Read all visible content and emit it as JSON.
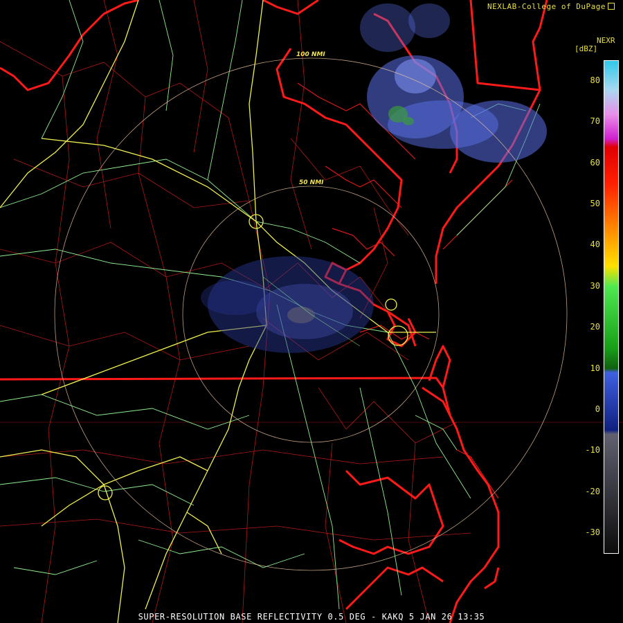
{
  "header": {
    "credit": "NEXLAB-College of DuPage",
    "credit_icon": "external-link-icon"
  },
  "legend": {
    "title": "NEXR",
    "unit": "[dBZ]",
    "ticks": [
      "80",
      "70",
      "60",
      "50",
      "40",
      "30",
      "20",
      "10",
      "0",
      "-10",
      "-20",
      "-30"
    ],
    "tick_values": [
      80,
      70,
      60,
      50,
      40,
      30,
      20,
      10,
      0,
      -10,
      -20,
      -30
    ],
    "range": [
      -35,
      85
    ],
    "color_stops": [
      {
        "value": 85,
        "color": "#30c8e8"
      },
      {
        "value": 78,
        "color": "#a8d8f0"
      },
      {
        "value": 72,
        "color": "#e890e8"
      },
      {
        "value": 66,
        "color": "#d020d0"
      },
      {
        "value": 64,
        "color": "#e00000"
      },
      {
        "value": 55,
        "color": "#ff2000"
      },
      {
        "value": 45,
        "color": "#ff8000"
      },
      {
        "value": 35,
        "color": "#ffe000"
      },
      {
        "value": 30,
        "color": "#50e850"
      },
      {
        "value": 15,
        "color": "#18a018"
      },
      {
        "value": 10,
        "color": "#106010"
      },
      {
        "value": 9,
        "color": "#4060e0"
      },
      {
        "value": -5,
        "color": "#102080"
      },
      {
        "value": -6,
        "color": "#606070"
      },
      {
        "value": -35,
        "color": "#0c0c0c"
      }
    ]
  },
  "rings": {
    "inner_label": "50 NMI",
    "outer_label": "100 NMI"
  },
  "colors": {
    "border": "#ff1a1a",
    "county": "#c01818",
    "roads": "#8ef08e",
    "interstate": "#f0f050",
    "echo": "#5a70e8",
    "ring": "#f0c8a0"
  },
  "footer": {
    "caption": "SUPER-RESOLUTION BASE REFLECTIVITY 0.5 DEG - KAKQ 5 JAN 26 13:35"
  }
}
